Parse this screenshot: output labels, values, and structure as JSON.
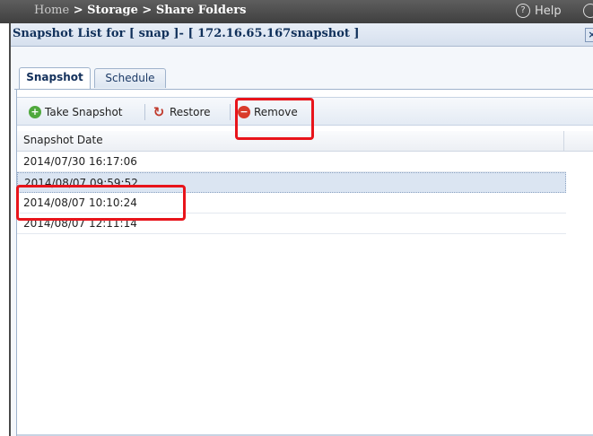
{
  "nav": {
    "home": "Home",
    "sep1": ">",
    "storage": "Storage",
    "sep2": ">",
    "share_folders": "Share Folders",
    "help_icon_glyph": "?",
    "help_label": "Help"
  },
  "window": {
    "title": "Snapshot List for [ snap ]- [ 172.16.65.167snapshot ]",
    "close_glyph": "×"
  },
  "tabs": [
    {
      "label": "Snapshot",
      "active": true
    },
    {
      "label": "Schedule",
      "active": false
    }
  ],
  "toolbar": {
    "take_snapshot": "Take Snapshot",
    "take_snapshot_icon": "+",
    "restore": "Restore",
    "restore_icon": "↻",
    "remove": "Remove",
    "remove_icon": "−"
  },
  "grid": {
    "column": "Snapshot Date",
    "rows": [
      "2014/07/30 16:17:06",
      "2014/08/07 09:59:52",
      "2014/08/07 10:10:24",
      "2014/08/07 12:11:14"
    ],
    "selected_row": "2014/08/07 09:59:52"
  },
  "colors": {
    "highlight": "#e8141b",
    "selection": "#dbe5f2",
    "title_text": "#10305a"
  }
}
